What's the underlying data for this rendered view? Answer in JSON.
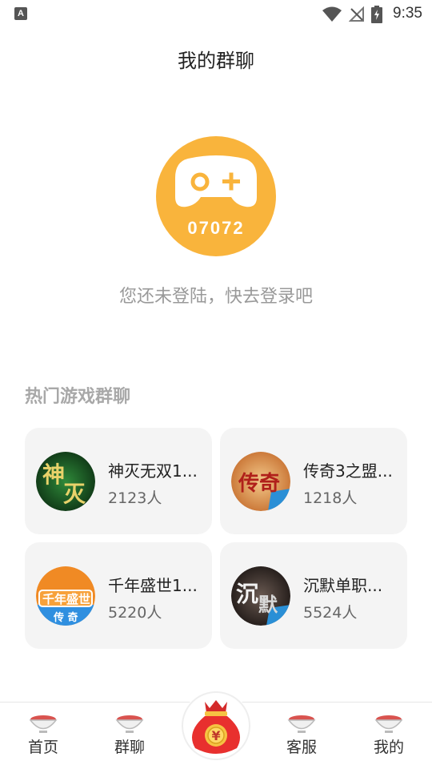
{
  "status_bar": {
    "left_icon": "A",
    "time": "9:35",
    "icons": [
      "wifi-icon",
      "no-signal-icon",
      "battery-charging-icon"
    ]
  },
  "header": {
    "title": "我的群聊"
  },
  "logo": {
    "text": "07072",
    "color": "#f9b43c"
  },
  "login_hint": "您还未登陆，快去登录吧",
  "hot_groups": {
    "title": "热门游戏群聊",
    "items": [
      {
        "name": "神灭无双1...",
        "count": "2123人",
        "icon": "shenmie-game-icon"
      },
      {
        "name": "传奇3之盟...",
        "count": "1218人",
        "icon": "chuanqi3-game-icon"
      },
      {
        "name": "千年盛世1...",
        "count": "5220人",
        "icon": "qiannian-game-icon"
      },
      {
        "name": "沉默单职...",
        "count": "5524人",
        "icon": "chenmo-game-icon"
      }
    ]
  },
  "bottom_nav": {
    "items": [
      {
        "label": "首页",
        "icon": "bowl-icon"
      },
      {
        "label": "群聊",
        "icon": "bowl-icon"
      },
      {
        "label": "",
        "icon": "money-bag-icon"
      },
      {
        "label": "客服",
        "icon": "bowl-icon"
      },
      {
        "label": "我的",
        "icon": "bowl-icon"
      }
    ]
  }
}
